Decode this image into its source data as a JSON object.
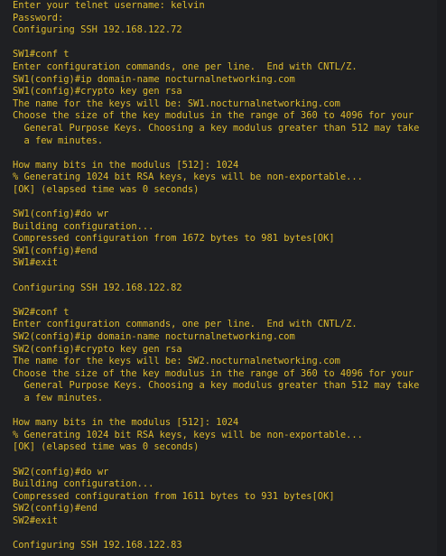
{
  "colors": {
    "background": "#1f2023",
    "text": "#e0bd2e"
  },
  "terminal": {
    "lines": [
      "Enter your telnet username: kelvin",
      "Password:",
      "Configuring SSH 192.168.122.72",
      "",
      "SW1#conf t",
      "Enter configuration commands, one per line.  End with CNTL/Z.",
      "SW1(config)#ip domain-name nocturnalnetworking.com",
      "SW1(config)#crypto key gen rsa",
      "The name for the keys will be: SW1.nocturnalnetworking.com",
      "Choose the size of the key modulus in the range of 360 to 4096 for your",
      "  General Purpose Keys. Choosing a key modulus greater than 512 may take",
      "  a few minutes.",
      "",
      "How many bits in the modulus [512]: 1024",
      "% Generating 1024 bit RSA keys, keys will be non-exportable...",
      "[OK] (elapsed time was 0 seconds)",
      "",
      "SW1(config)#do wr",
      "Building configuration...",
      "Compressed configuration from 1672 bytes to 981 bytes[OK]",
      "SW1(config)#end",
      "SW1#exit",
      "",
      "Configuring SSH 192.168.122.82",
      "",
      "SW2#conf t",
      "Enter configuration commands, one per line.  End with CNTL/Z.",
      "SW2(config)#ip domain-name nocturnalnetworking.com",
      "SW2(config)#crypto key gen rsa",
      "The name for the keys will be: SW2.nocturnalnetworking.com",
      "Choose the size of the key modulus in the range of 360 to 4096 for your",
      "  General Purpose Keys. Choosing a key modulus greater than 512 may take",
      "  a few minutes.",
      "",
      "How many bits in the modulus [512]: 1024",
      "% Generating 1024 bit RSA keys, keys will be non-exportable...",
      "[OK] (elapsed time was 0 seconds)",
      "",
      "SW2(config)#do wr",
      "Building configuration...",
      "Compressed configuration from 1611 bytes to 931 bytes[OK]",
      "SW2(config)#end",
      "SW2#exit",
      "",
      "Configuring SSH 192.168.122.83"
    ]
  }
}
